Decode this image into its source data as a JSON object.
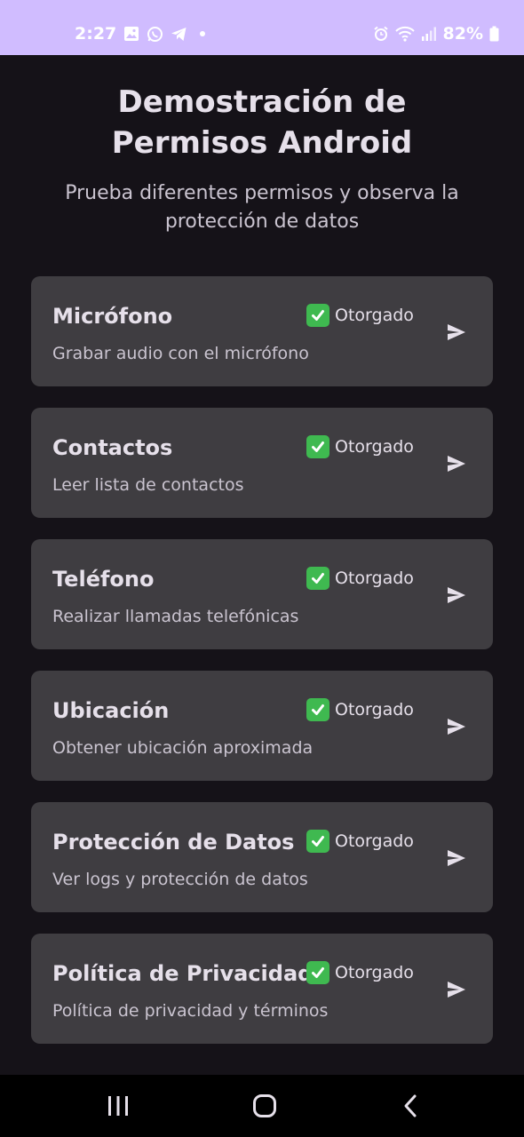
{
  "status_bar": {
    "time": "2:27",
    "battery": "82%",
    "icons": [
      "gallery-icon",
      "whatsapp-icon",
      "telegram-icon",
      "dot-icon",
      "alarm-icon",
      "wifi-icon",
      "signal-icon",
      "battery-icon"
    ]
  },
  "header": {
    "title": "Demostración de Permisos Android",
    "subtitle": "Prueba diferentes permisos y observa la protección de datos"
  },
  "permissions": [
    {
      "title": "Micrófono",
      "description": "Grabar audio con el micrófono",
      "status": "Otorgado"
    },
    {
      "title": "Contactos",
      "description": "Leer lista de contactos",
      "status": "Otorgado"
    },
    {
      "title": "Teléfono",
      "description": "Realizar llamadas telefónicas",
      "status": "Otorgado"
    },
    {
      "title": "Ubicación",
      "description": "Obtener ubicación aproximada",
      "status": "Otorgado"
    },
    {
      "title": "Protección de Datos",
      "description": "Ver logs y protección de datos",
      "status": "Otorgado"
    },
    {
      "title": "Política de Privacidad",
      "description": "Política de privacidad y términos",
      "status": "Otorgado"
    }
  ],
  "colors": {
    "status_bar": "#d0bcff",
    "background": "#151218",
    "card": "#3f3d41",
    "granted_check": "#3fb950"
  }
}
